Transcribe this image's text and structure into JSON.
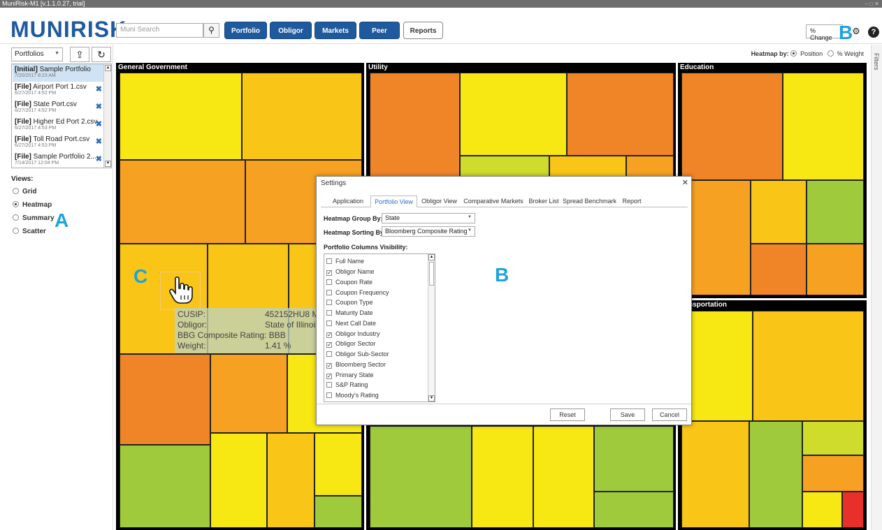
{
  "window": {
    "title": "MuniRisk-M1 [v.1.1.0.27, trial]",
    "controls": "– □ ✕"
  },
  "header": {
    "logo": "MUNIRISK",
    "logo_tm": "TM",
    "search_placeholder": "Muni Search",
    "nav": [
      "Portfolio",
      "Obligor",
      "Markets",
      "Peer",
      "Reports"
    ],
    "change_select": "% Change",
    "callout_b_top": "B"
  },
  "sidebar": {
    "portfolio_select": "Portfolios",
    "portfolios": [
      {
        "prefix": "[Initial]",
        "name": "Sample Portfolio",
        "date": "7/20/2017 8:23 AM"
      },
      {
        "prefix": "[File]",
        "name": "Airport Port 1.csv",
        "date": "6/27/2017 4:52 PM"
      },
      {
        "prefix": "[File]",
        "name": "State Port.csv",
        "date": "6/27/2017 4:52 PM"
      },
      {
        "prefix": "[File]",
        "name": "Higher Ed Port 2.csv",
        "date": "6/27/2017 4:53 PM"
      },
      {
        "prefix": "[File]",
        "name": "Toll Road Port.csv",
        "date": "6/27/2017 4:53 PM"
      },
      {
        "prefix": "[File]",
        "name": "Sample Portfolio 2....",
        "date": "7/14/2017 12:04 PM"
      }
    ],
    "views_title": "Views:",
    "views": [
      "Grid",
      "Heatmap",
      "Summary",
      "Scatter"
    ],
    "selected_view": "Heatmap",
    "callout_a": "A"
  },
  "heatmap": {
    "by_label": "Heatmap by:",
    "options": [
      "Position",
      "% Weight"
    ],
    "selected": "Position",
    "sectors": [
      "General Government",
      "Utility",
      "Education",
      "Transportation"
    ],
    "filters_tab": "Filters"
  },
  "tooltip": {
    "rows": [
      {
        "k": "CUSIP:",
        "v": "452152HU8 M"
      },
      {
        "k": "Obligor:",
        "v": "State of Illinois"
      },
      {
        "k": "BBG Composite Rating:",
        "v": "BBB"
      },
      {
        "k": "Weight:",
        "v": "1.41 %"
      }
    ],
    "callout_c": "C"
  },
  "settings": {
    "title": "Settings",
    "tabs": [
      "Application",
      "Portfolio View",
      "Obligor View",
      "Comparative Markets",
      "Broker List",
      "Spread Benchmark",
      "Report"
    ],
    "active_tab": "Portfolio View",
    "group_by_label": "Heatmap Group By:",
    "group_by_value": "State",
    "sort_by_label": "Heatmap Sorting By:",
    "sort_by_value": "Bloomberg Composite Rating",
    "columns_label": "Portfolio Columns Visibility:",
    "columns": [
      {
        "name": "Full Name",
        "checked": false
      },
      {
        "name": "Obligor Name",
        "checked": true
      },
      {
        "name": "Coupon Rate",
        "checked": false
      },
      {
        "name": "Coupon Frequency",
        "checked": false
      },
      {
        "name": "Coupon Type",
        "checked": false
      },
      {
        "name": "Maturity Date",
        "checked": false
      },
      {
        "name": "Next Call Date",
        "checked": false
      },
      {
        "name": "Obligor Industry",
        "checked": true
      },
      {
        "name": "Obligor Sector",
        "checked": true
      },
      {
        "name": "Obligor Sub-Sector",
        "checked": false
      },
      {
        "name": "Bloomberg Sector",
        "checked": true
      },
      {
        "name": "Primary State",
        "checked": true
      },
      {
        "name": "S&P Rating",
        "checked": false
      },
      {
        "name": "Moody's Rating",
        "checked": false
      }
    ],
    "buttons": {
      "reset": "Reset",
      "save": "Save",
      "cancel": "Cancel"
    },
    "callout_b": "B"
  },
  "colors": {
    "brand": "#1f5a9e",
    "callout": "#1ea3dc",
    "selection": "#cfe3f5"
  }
}
